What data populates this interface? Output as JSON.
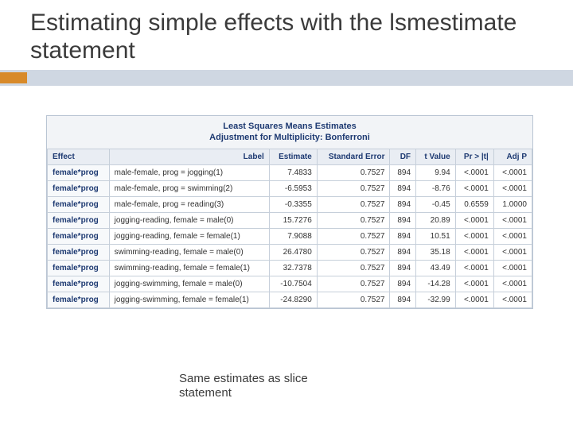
{
  "title": "Estimating simple effects with the lsmestimate statement",
  "table": {
    "title_line1": "Least Squares Means Estimates",
    "title_line2": "Adjustment for Multiplicity: Bonferroni",
    "headers": {
      "effect": "Effect",
      "label": "Label",
      "estimate": "Estimate",
      "stderr": "Standard Error",
      "df": "DF",
      "tvalue": "t Value",
      "pr": "Pr > |t|",
      "adjp": "Adj P"
    },
    "rows": [
      {
        "effect": "female*prog",
        "label": "male-female, prog = jogging(1)",
        "estimate": "7.4833",
        "stderr": "0.7527",
        "df": "894",
        "tvalue": "9.94",
        "pr": "<.0001",
        "adjp": "<.0001"
      },
      {
        "effect": "female*prog",
        "label": "male-female, prog = swimming(2)",
        "estimate": "-6.5953",
        "stderr": "0.7527",
        "df": "894",
        "tvalue": "-8.76",
        "pr": "<.0001",
        "adjp": "<.0001"
      },
      {
        "effect": "female*prog",
        "label": "male-female, prog = reading(3)",
        "estimate": "-0.3355",
        "stderr": "0.7527",
        "df": "894",
        "tvalue": "-0.45",
        "pr": "0.6559",
        "adjp": "1.0000"
      },
      {
        "effect": "female*prog",
        "label": "jogging-reading, female = male(0)",
        "estimate": "15.7276",
        "stderr": "0.7527",
        "df": "894",
        "tvalue": "20.89",
        "pr": "<.0001",
        "adjp": "<.0001"
      },
      {
        "effect": "female*prog",
        "label": "jogging-reading, female = female(1)",
        "estimate": "7.9088",
        "stderr": "0.7527",
        "df": "894",
        "tvalue": "10.51",
        "pr": "<.0001",
        "adjp": "<.0001"
      },
      {
        "effect": "female*prog",
        "label": "swimming-reading, female = male(0)",
        "estimate": "26.4780",
        "stderr": "0.7527",
        "df": "894",
        "tvalue": "35.18",
        "pr": "<.0001",
        "adjp": "<.0001"
      },
      {
        "effect": "female*prog",
        "label": "swimming-reading, female = female(1)",
        "estimate": "32.7378",
        "stderr": "0.7527",
        "df": "894",
        "tvalue": "43.49",
        "pr": "<.0001",
        "adjp": "<.0001"
      },
      {
        "effect": "female*prog",
        "label": "jogging-swimming, female = male(0)",
        "estimate": "-10.7504",
        "stderr": "0.7527",
        "df": "894",
        "tvalue": "-14.28",
        "pr": "<.0001",
        "adjp": "<.0001"
      },
      {
        "effect": "female*prog",
        "label": "jogging-swimming, female = female(1)",
        "estimate": "-24.8290",
        "stderr": "0.7527",
        "df": "894",
        "tvalue": "-32.99",
        "pr": "<.0001",
        "adjp": "<.0001"
      }
    ]
  },
  "caption": "Same estimates as slice statement",
  "chart_data": {
    "type": "table",
    "title": "Least Squares Means Estimates — Adjustment for Multiplicity: Bonferroni",
    "columns": [
      "Effect",
      "Label",
      "Estimate",
      "Standard Error",
      "DF",
      "t Value",
      "Pr > |t|",
      "Adj P"
    ],
    "rows": [
      [
        "female*prog",
        "male-female, prog = jogging(1)",
        7.4833,
        0.7527,
        894,
        9.94,
        "<.0001",
        "<.0001"
      ],
      [
        "female*prog",
        "male-female, prog = swimming(2)",
        -6.5953,
        0.7527,
        894,
        -8.76,
        "<.0001",
        "<.0001"
      ],
      [
        "female*prog",
        "male-female, prog = reading(3)",
        -0.3355,
        0.7527,
        894,
        -0.45,
        0.6559,
        1.0
      ],
      [
        "female*prog",
        "jogging-reading, female = male(0)",
        15.7276,
        0.7527,
        894,
        20.89,
        "<.0001",
        "<.0001"
      ],
      [
        "female*prog",
        "jogging-reading, female = female(1)",
        7.9088,
        0.7527,
        894,
        10.51,
        "<.0001",
        "<.0001"
      ],
      [
        "female*prog",
        "swimming-reading, female = male(0)",
        26.478,
        0.7527,
        894,
        35.18,
        "<.0001",
        "<.0001"
      ],
      [
        "female*prog",
        "swimming-reading, female = female(1)",
        32.7378,
        0.7527,
        894,
        43.49,
        "<.0001",
        "<.0001"
      ],
      [
        "female*prog",
        "jogging-swimming, female = male(0)",
        -10.7504,
        0.7527,
        894,
        -14.28,
        "<.0001",
        "<.0001"
      ],
      [
        "female*prog",
        "jogging-swimming, female = female(1)",
        -24.829,
        0.7527,
        894,
        -32.99,
        "<.0001",
        "<.0001"
      ]
    ]
  }
}
